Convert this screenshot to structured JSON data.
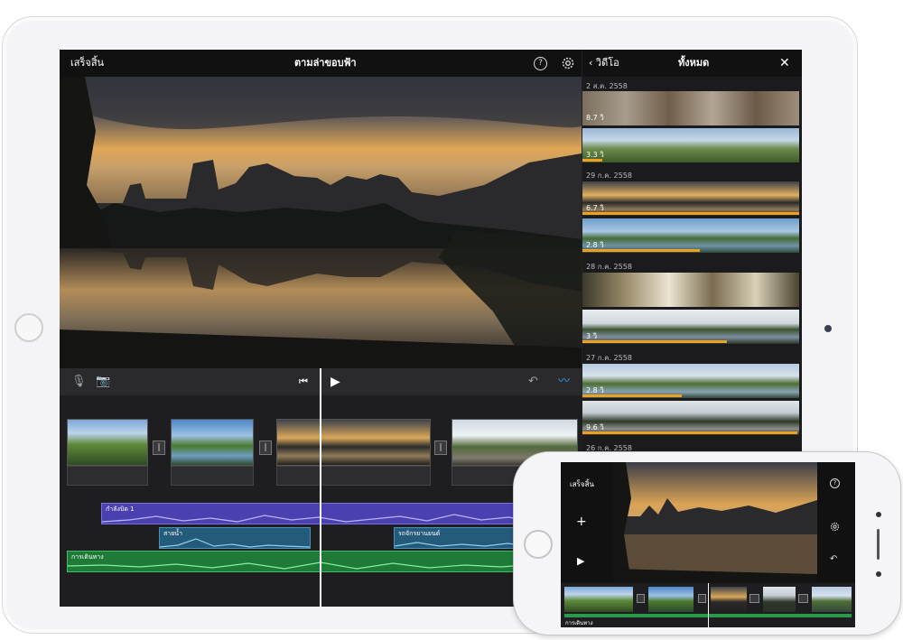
{
  "ipad": {
    "topbar": {
      "done_label": "เสร็จสิ้น",
      "project_title": "ตามล่าขอบฟ้า",
      "help_icon": "question-circle-icon",
      "settings_icon": "gear-icon"
    },
    "browser": {
      "back_label": "วิดีโอ",
      "title": "ทั้งหมด",
      "close_icon": "close-x-icon",
      "sections": [
        {
          "date": "2 ส.ค. 2558",
          "clips": [
            {
              "duration": "8.7 วิ"
            },
            {
              "duration": "3.3 วิ"
            }
          ]
        },
        {
          "date": "29 ก.ค. 2558",
          "clips": [
            {
              "duration": "6.7 วิ"
            },
            {
              "duration": "2.8 วิ"
            }
          ]
        },
        {
          "date": "28 ก.ค. 2558",
          "clips": [
            {
              "duration": ""
            },
            {
              "duration": "3 วิ"
            }
          ]
        },
        {
          "date": "27 ก.ค. 2558",
          "clips": [
            {
              "duration": "2.8 วิ"
            },
            {
              "duration": "9.6 วิ"
            }
          ]
        },
        {
          "date": "26 ก.ค. 2558",
          "clips": []
        }
      ]
    },
    "controls": {
      "mic_icon": "microphone-icon",
      "camera_icon": "camera-icon",
      "skip_back_icon": "skip-to-start-icon",
      "play_icon": "play-icon",
      "undo_icon": "undo-icon",
      "waveform_icon": "audio-waveform-icon"
    },
    "timeline": {
      "tracks": [
        {
          "label": "กำลังบิด 1",
          "color": "#5a4fc6"
        },
        {
          "label": "สายน้ำ",
          "color": "#2e6f93"
        },
        {
          "label": "รถจักรยานยนต์",
          "color": "#2e6f93"
        },
        {
          "label": "การเดินทาง",
          "color": "#2a9a4a"
        }
      ]
    }
  },
  "iphone": {
    "done_label": "เสร็จสิ้น",
    "add_icon": "plus-icon",
    "play_icon": "play-icon",
    "help_icon": "question-circle-icon",
    "settings_icon": "gear-icon",
    "undo_icon": "undo-icon",
    "track_label": "การเดินทาง"
  },
  "colors": {
    "accent_orange": "#f0a020",
    "audio_purple": "#5a4fc6",
    "audio_blue": "#2e6f93",
    "music_green": "#2a9a4a"
  }
}
